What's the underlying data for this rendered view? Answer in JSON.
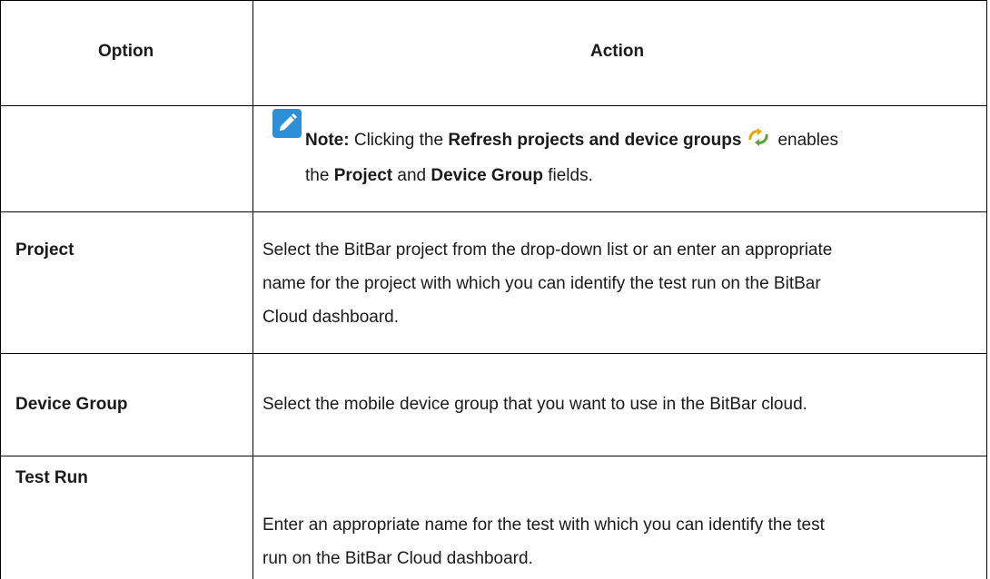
{
  "table": {
    "header": {
      "option": "Option",
      "action": "Action"
    },
    "note": {
      "label": "Note:",
      "text1": "Clicking the",
      "bold1": "Refresh projects and device groups",
      "text2": "enables",
      "text3": "the",
      "bold2": "Project",
      "text4": "and",
      "bold3": "Device Group",
      "text5": "fields."
    },
    "rows": [
      {
        "option": "Project",
        "action_lines": [
          "Select the BitBar project from the drop-down list or an enter an appropriate",
          "name for the project with which you can identify the test run on the BitBar",
          "Cloud dashboard."
        ]
      },
      {
        "option": "Device Group",
        "action_lines": [
          "Select the mobile device group that you want to use in the BitBar cloud."
        ]
      },
      {
        "option": "Test Run",
        "action_lines": [
          "Enter an appropriate name for the test with which you can identify the test",
          "run on the BitBar Cloud dashboard."
        ]
      }
    ]
  },
  "icons": {
    "note": "pencil-note-icon",
    "refresh": "refresh-arrows-icon"
  },
  "colors": {
    "note_icon": "#2e8fd9",
    "refresh_icon": "#e6a700",
    "border": "#000000"
  }
}
